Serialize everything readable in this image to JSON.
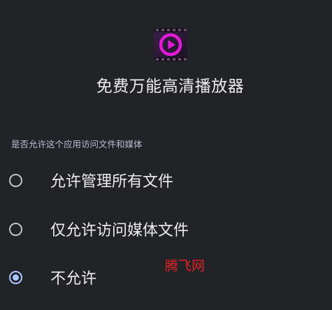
{
  "app": {
    "icon": "play-circle-icon",
    "title": "免费万能高清播放器"
  },
  "permission": {
    "question": "是否允许这个应用访问文件和媒体",
    "options": [
      {
        "label": "允许管理所有文件",
        "selected": false
      },
      {
        "label": "仅允许访问媒体文件",
        "selected": false
      },
      {
        "label": "不允许",
        "selected": true
      }
    ]
  },
  "watermark": "腾飞网",
  "colors": {
    "background": "#222326",
    "accent": "#AEC7FF",
    "icon_magenta": "#E21BD7"
  }
}
